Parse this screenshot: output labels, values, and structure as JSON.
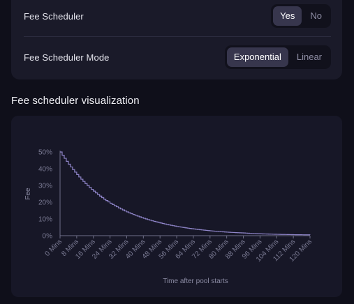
{
  "settings": {
    "fee_scheduler": {
      "label": "Fee Scheduler",
      "options": [
        "Yes",
        "No"
      ],
      "selected": "Yes"
    },
    "fee_scheduler_mode": {
      "label": "Fee Scheduler Mode",
      "options": [
        "Exponential",
        "Linear"
      ],
      "selected": "Exponential"
    }
  },
  "visualization": {
    "title": "Fee scheduler visualization"
  },
  "colors": {
    "line": "#8f85c9",
    "axis": "#6f6f88",
    "active_segment": "#37364d"
  },
  "chart_data": {
    "type": "line",
    "title": "",
    "xlabel": "Time after pool starts",
    "ylabel": "Fee",
    "y_ticks": [
      "0%",
      "10%",
      "20%",
      "30%",
      "40%",
      "50%"
    ],
    "x_ticks": [
      "0 Mins",
      "8 Mins",
      "16 Mins",
      "24 Mins",
      "32 Mins",
      "40 Mins",
      "48 Mins",
      "56 Mins",
      "64 Mins",
      "72 Mins",
      "80 Mins",
      "88 Mins",
      "96 Mins",
      "104 Mins",
      "112 Mins",
      "120 Mins"
    ],
    "xlim": [
      0,
      120
    ],
    "ylim": [
      0,
      50
    ],
    "grid": false,
    "step": true,
    "series": [
      {
        "x": [
          0,
          8,
          16,
          24,
          32,
          40,
          48,
          56,
          64,
          72,
          80,
          88,
          96,
          104,
          112,
          120
        ],
        "y": [
          50,
          36.5,
          26.6,
          19.4,
          14.2,
          10.4,
          7.6,
          5.5,
          4.0,
          2.9,
          2.1,
          1.6,
          1.1,
          0.8,
          0.6,
          0.5
        ]
      }
    ]
  }
}
